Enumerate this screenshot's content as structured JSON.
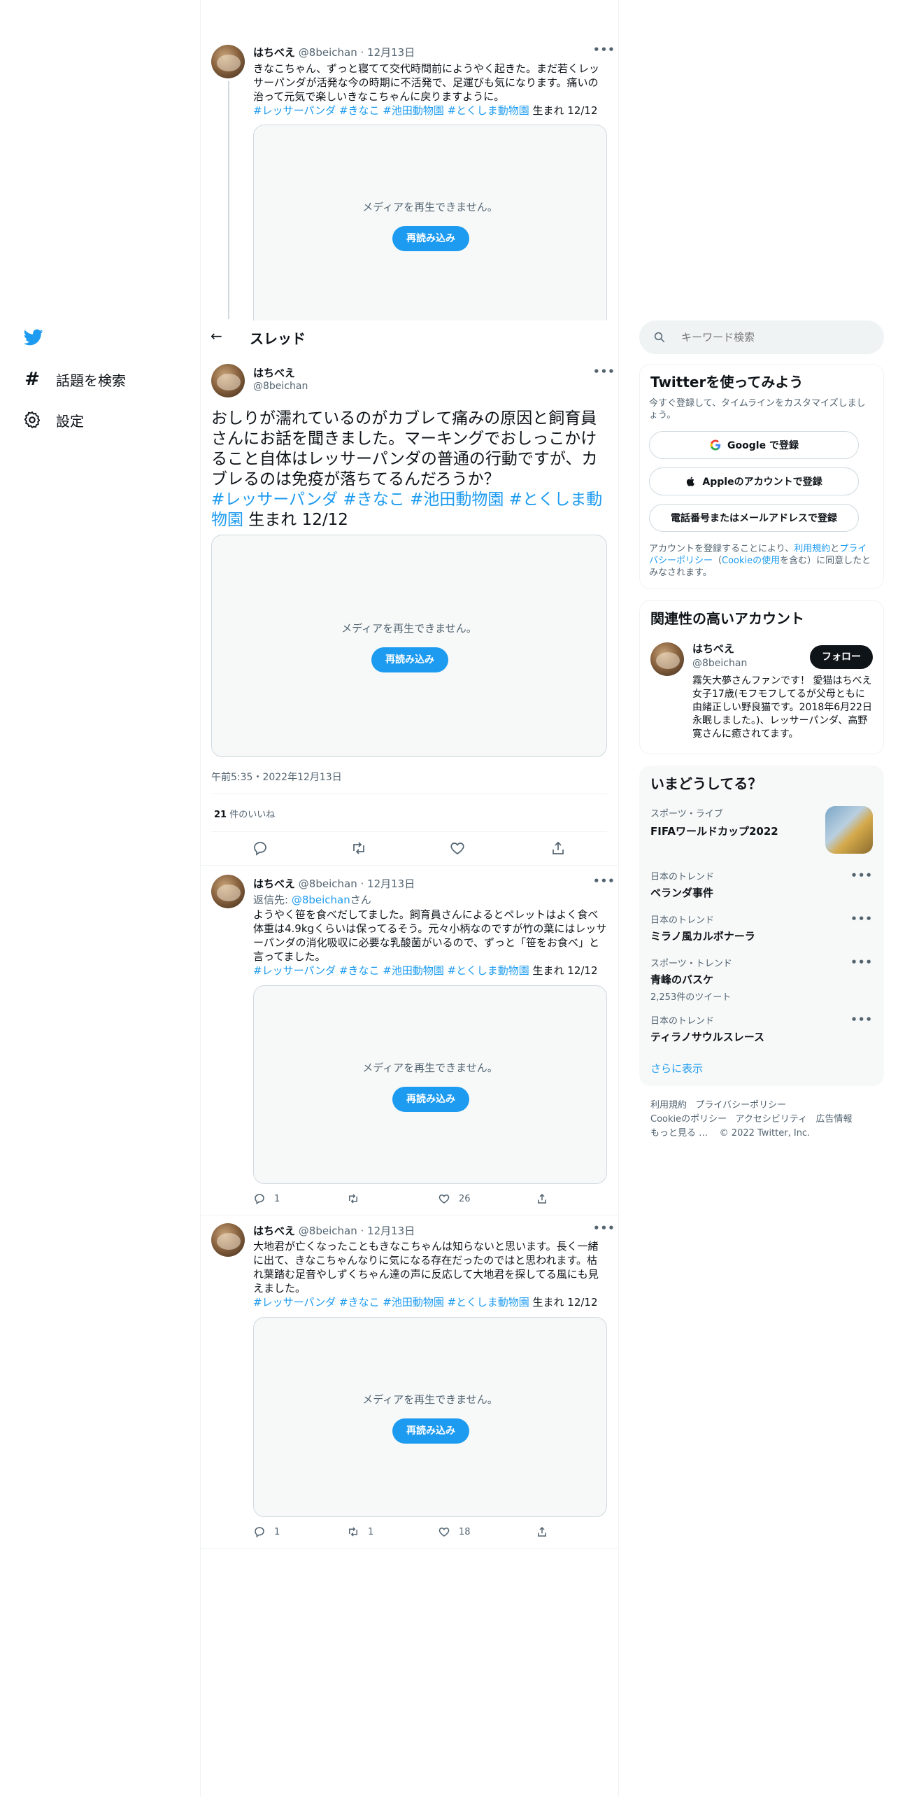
{
  "nav": {
    "home_icon": "twitter-bird-icon",
    "explore_label": "話題を検索",
    "settings_label": "設定"
  },
  "header": {
    "title": "スレッド"
  },
  "search": {
    "placeholder": "キーワード検索"
  },
  "tweet_prev": {
    "name": "はちべえ",
    "handle": "@8beichan",
    "date": "· 12月13日",
    "text": "きなこちゃん、ずっと寝てて交代時間前にようやく起きた。まだ若くレッサーパンダが活発な今の時期に不活発で、足運びも気になります。痛いの治って元気で楽しいきなこちゃんに戻りますように。",
    "hashtags": "#レッサーパンダ #きなこ #池田動物園 #とくしま動物園",
    "tail": " 生まれ 12/12",
    "media_text": "メディアを再生できません。",
    "reload": "再読み込み"
  },
  "main_tweet": {
    "name": "はちべえ",
    "handle": "@8beichan",
    "text": "おしりが濡れているのがカブレて痛みの原因と飼育員さんにお話を聞きました。マーキングでおしっこかけること自体はレッサーパンダの普通の行動ですが、カブレるのは免疫が落ちてるんだろうか？",
    "hashtags": "#レッサーパンダ #きなこ #池田動物園 #とくしま動物園",
    "tail": " 生まれ 12/12",
    "media_text": "メディアを再生できません。",
    "reload": "再読み込み",
    "timestamp": "午前5:35・2022年12月13日",
    "likes_count": "21",
    "likes_label": " 件のいいね"
  },
  "reply1": {
    "name": "はちべえ",
    "handle": "@8beichan",
    "date": "· 12月13日",
    "reply_to_prefix": "返信先: ",
    "reply_to": "@8beichan",
    "reply_to_suffix": "さん",
    "text": "ようやく笹を食べだしてました。飼育員さんによるとペレットはよく食べ体重は4.9kgくらいは保ってるそう。元々小柄なのですが竹の葉にはレッサーパンダの消化吸収に必要な乳酸菌がいるので、ずっと「笹をお食べ」と言ってました。",
    "hashtags": "#レッサーパンダ #きなこ #池田動物園 #とくしま動物園",
    "tail": " 生まれ 12/12",
    "media_text": "メディアを再生できません。",
    "reload": "再読み込み",
    "replies": "1",
    "retweets": "",
    "likes": "26"
  },
  "reply2": {
    "name": "はちべえ",
    "handle": "@8beichan",
    "date": "· 12月13日",
    "text": "大地君が亡くなったこともきなこちゃんは知らないと思います。長く一緒に出て、きなこちゃんなりに気になる存在だったのではと思われます。枯れ葉踏む足音やしずくちゃん達の声に反応して大地君を探してる風にも見えました。",
    "hashtags": "#レッサーパンダ #きなこ #池田動物園 #とくしま動物園",
    "tail": " 生まれ 12/12",
    "media_text": "メディアを再生できません。",
    "reload": "再読み込み",
    "replies": "1",
    "retweets": "1",
    "likes": "18"
  },
  "signup": {
    "title": "Twitterを使ってみよう",
    "subtitle": "今すぐ登録して、タイムラインをカスタマイズしましょう。",
    "google_btn": "Google で登録",
    "apple_btn": "Appleのアカウントで登録",
    "phone_btn": "電話番号またはメールアドレスで登録",
    "legal_1": "アカウントを登録することにより、",
    "terms": "利用規約",
    "legal_and": "と",
    "privacy": "プライバシーポリシー",
    "legal_paren_open": "（",
    "cookie": "Cookieの使用",
    "legal_2": "を含む）に同意したとみなされます。"
  },
  "related": {
    "title": "関連性の高いアカウント",
    "name": "はちべえ",
    "handle": "@8beichan",
    "follow": "フォロー",
    "bio": "霧矢大夢さんファンです！ 愛猫はちべえ女子17歳(モフモフしてるが父母ともに由緒正しい野良猫です。2018年6月22日永眠しました。)、レッサーパンダ、高野寛さんに癒されてます。"
  },
  "trends": {
    "title": "いまどうしてる？",
    "items": [
      {
        "context": "スポーツ・ライブ",
        "name": "FIFAワールドカップ2022",
        "count": ""
      },
      {
        "context": "日本のトレンド",
        "name": "ベランダ事件",
        "count": ""
      },
      {
        "context": "日本のトレンド",
        "name": "ミラノ風カルボナーラ",
        "count": ""
      },
      {
        "context": "スポーツ・トレンド",
        "name": "青峰のバスケ",
        "count": "2,253件のツイート"
      },
      {
        "context": "日本のトレンド",
        "name": "ティラノサウルスレース",
        "count": ""
      }
    ],
    "show_more": "さらに表示"
  },
  "footer": {
    "links_row1": [
      "利用規約",
      "プライバシーポリシー"
    ],
    "links_row2": [
      "Cookieのポリシー",
      "アクセシビリティ",
      "広告情報"
    ],
    "more": "もっと見る …",
    "copyright": "© 2022 Twitter, Inc."
  },
  "colors": {
    "accent": "#1d9bf0",
    "text": "#0f1419",
    "muted": "#536471",
    "border": "#eff3f4"
  }
}
